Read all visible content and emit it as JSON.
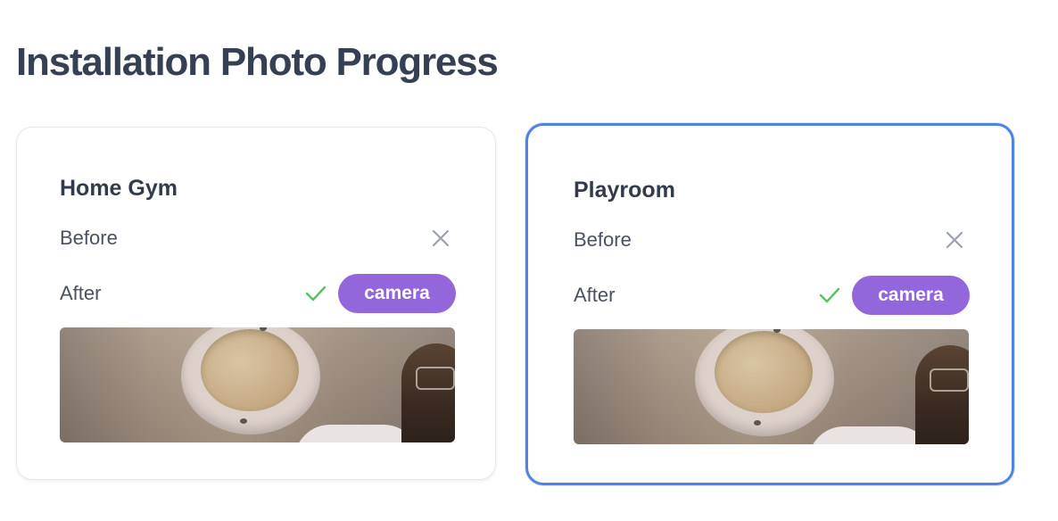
{
  "page": {
    "title": "Installation Photo Progress"
  },
  "cards": [
    {
      "title": "Home Gym",
      "selected": false,
      "before_label": "Before",
      "before_status": "x-icon",
      "after_label": "After",
      "after_status": "check-icon",
      "camera_label": "camera",
      "photo": "after-photo"
    },
    {
      "title": "Playroom",
      "selected": true,
      "before_label": "Before",
      "before_status": "x-icon",
      "after_label": "After",
      "after_status": "check-icon",
      "camera_label": "camera",
      "photo": "after-photo"
    }
  ],
  "colors": {
    "title_text": "#354052",
    "card_border": "#e3e6ea",
    "selected_border": "#4f83e0",
    "camera_badge": "#9466dc",
    "check_green": "#5bbf6a",
    "x_gray": "#9aa1ac"
  }
}
